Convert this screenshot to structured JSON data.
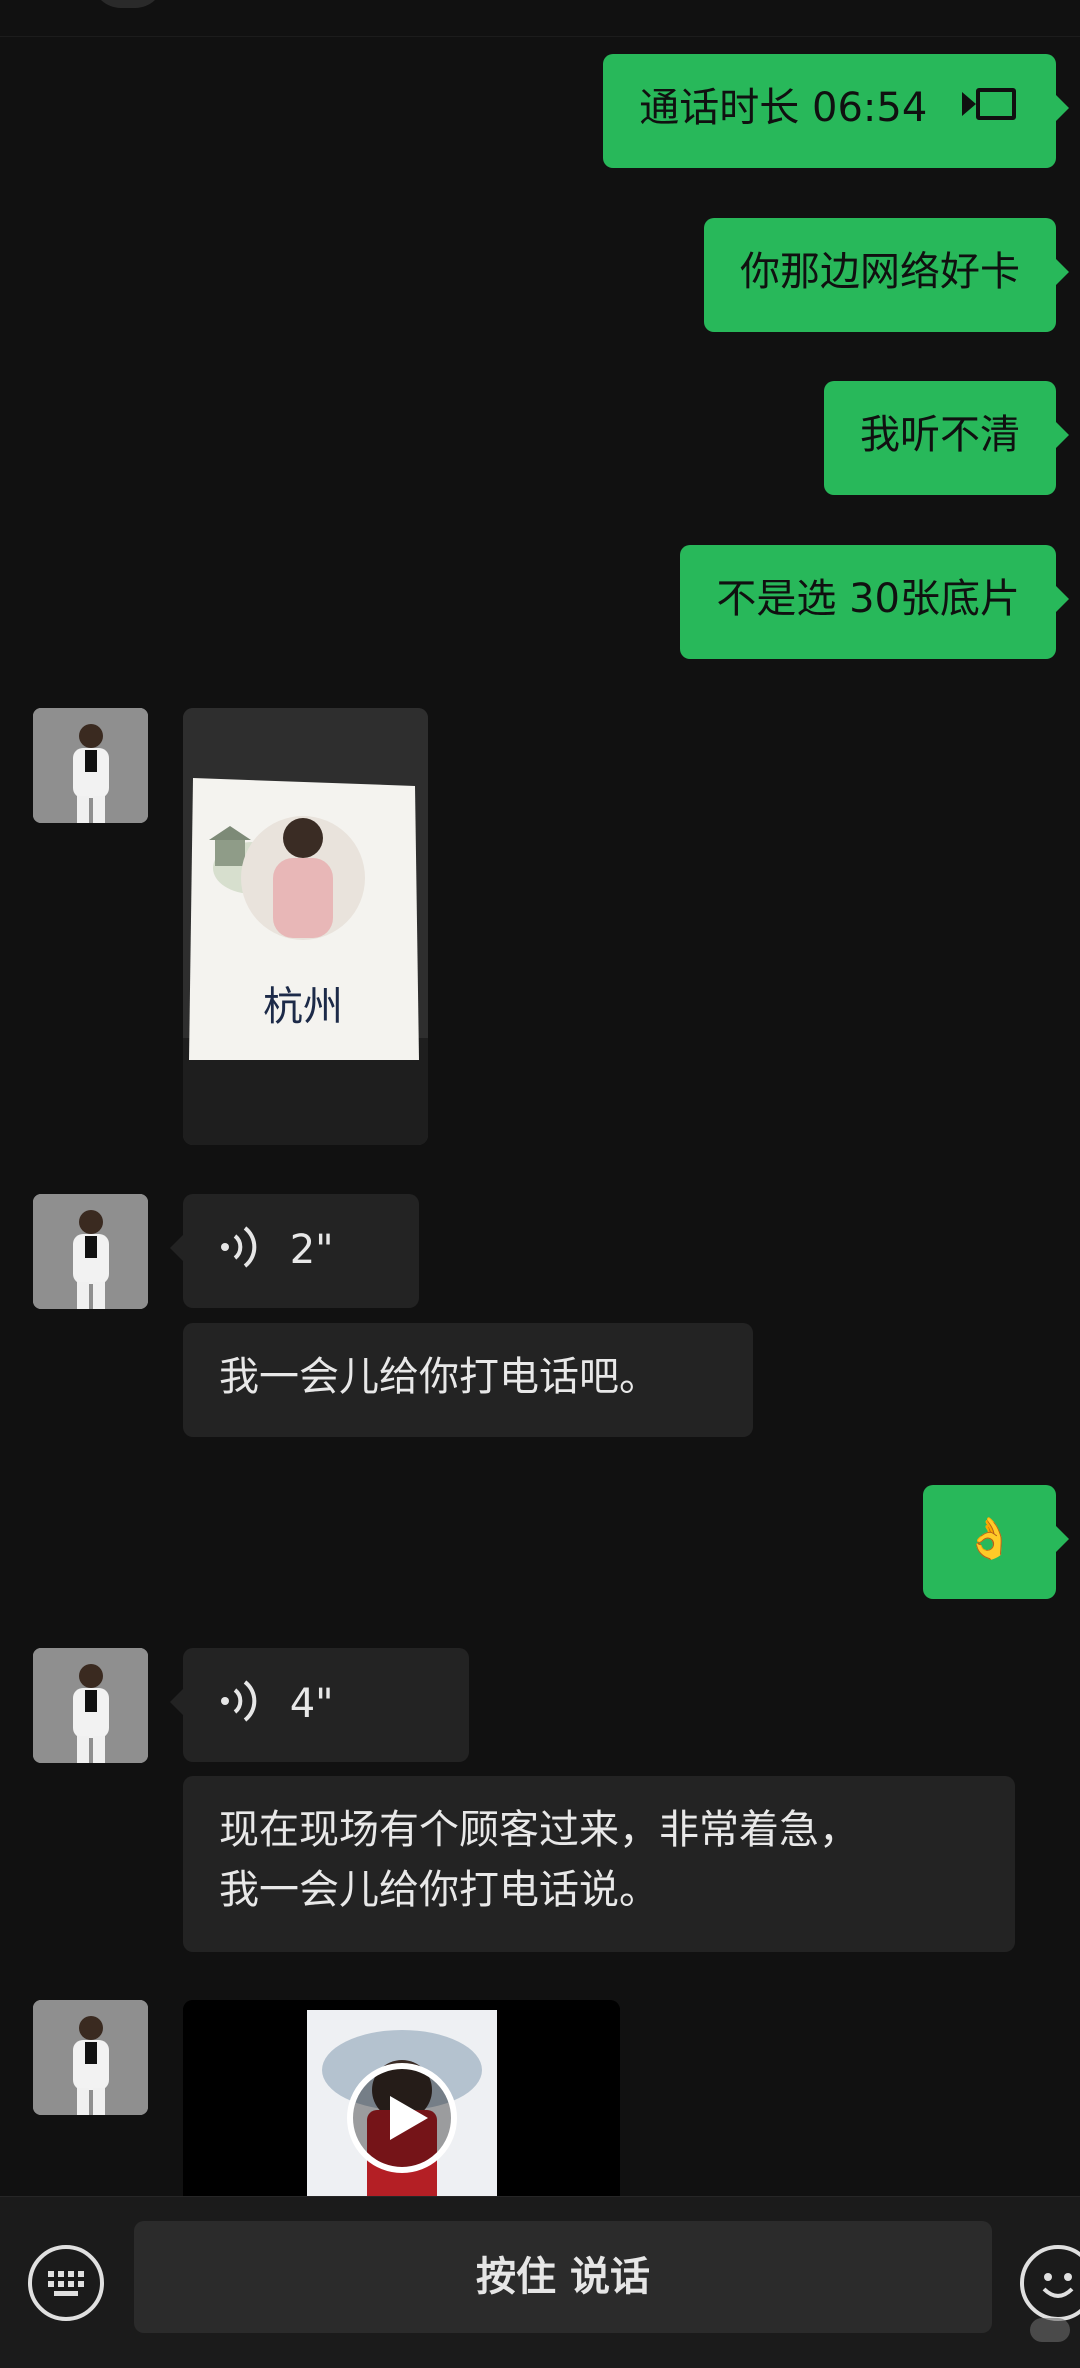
{
  "messages": {
    "call_duration": "通话时长 06:54",
    "out_1": "你那边网络好卡",
    "out_2": "我听不清",
    "out_3": "不是选 30张底片",
    "voice_1": "2\"",
    "in_text_1": "我一会儿给你打电话吧。",
    "out_emoji": "👌",
    "voice_2": "4\"",
    "in_text_2_line1": "现在现场有个顾客过来，非常着急，",
    "in_text_2_line2": "我一会儿给你打电话说。"
  },
  "photo": {
    "caption": "杭州"
  },
  "input_bar": {
    "hold_to_talk": "按住 说话"
  },
  "colors": {
    "background": "#111111",
    "outgoing_bubble": "#28b85a",
    "incoming_bubble": "#232323"
  }
}
